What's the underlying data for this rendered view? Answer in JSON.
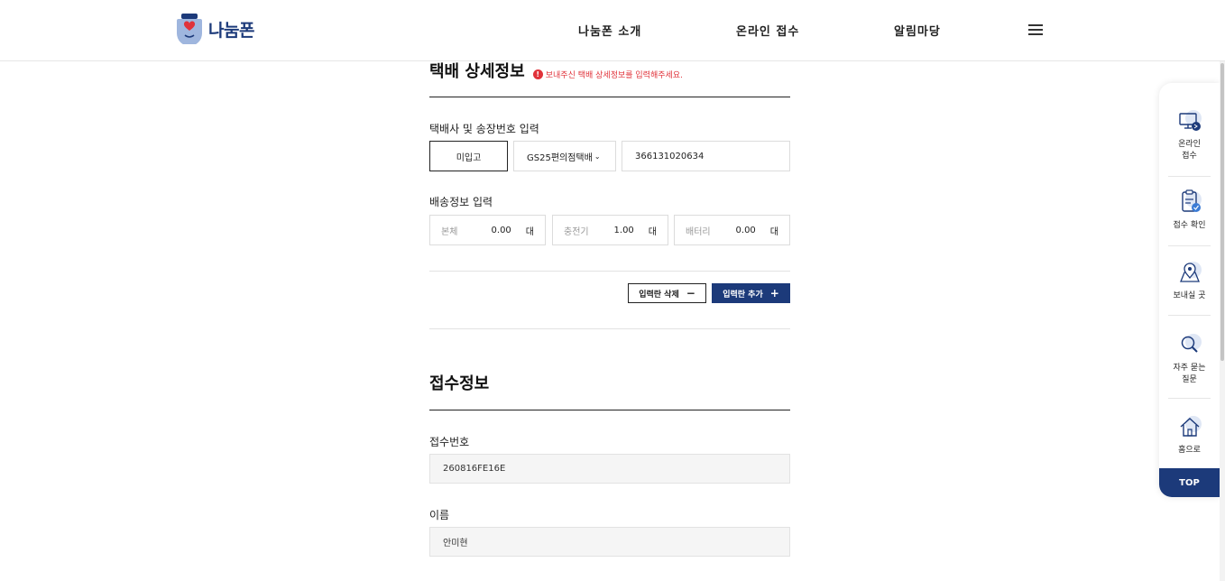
{
  "header": {
    "logo_text": "나눔폰",
    "nav": [
      "나눔폰 소개",
      "온라인 접수",
      "알림마당"
    ]
  },
  "delivery": {
    "title": "택배 상세정보",
    "warning": "보내주신 택배 상세정보를 입력해주세요.",
    "courier_label": "택배사 및 송장번호 입력",
    "status_value": "미입고",
    "courier_select": "GS25편의점택배",
    "tracking_number": "366131020634",
    "shipping_label": "배송정보 입력",
    "items": [
      {
        "name": "본체",
        "value": "0.00",
        "unit": "대"
      },
      {
        "name": "충전기",
        "value": "1.00",
        "unit": "대"
      },
      {
        "name": "배터리",
        "value": "0.00",
        "unit": "대"
      }
    ],
    "remove_button": "입력란 삭제",
    "add_button": "입력란 추가"
  },
  "receipt": {
    "title": "접수정보",
    "number_label": "접수번호",
    "number_value": "260816FE16E",
    "name_label": "이름",
    "name_value": "안미현"
  },
  "sidebar": {
    "items": [
      {
        "label": "온라인\n접수",
        "icon": "computer-icon"
      },
      {
        "label": "접수 확인",
        "icon": "clipboard-check-icon"
      },
      {
        "label": "보내실 곳",
        "icon": "map-pin-icon"
      },
      {
        "label": "자주 묻는\n질문",
        "icon": "magnifier-icon"
      },
      {
        "label": "홈으로",
        "icon": "home-icon"
      }
    ],
    "top_label": "TOP"
  },
  "colors": {
    "brand": "#1c3a7a",
    "warning": "#e0323a"
  }
}
